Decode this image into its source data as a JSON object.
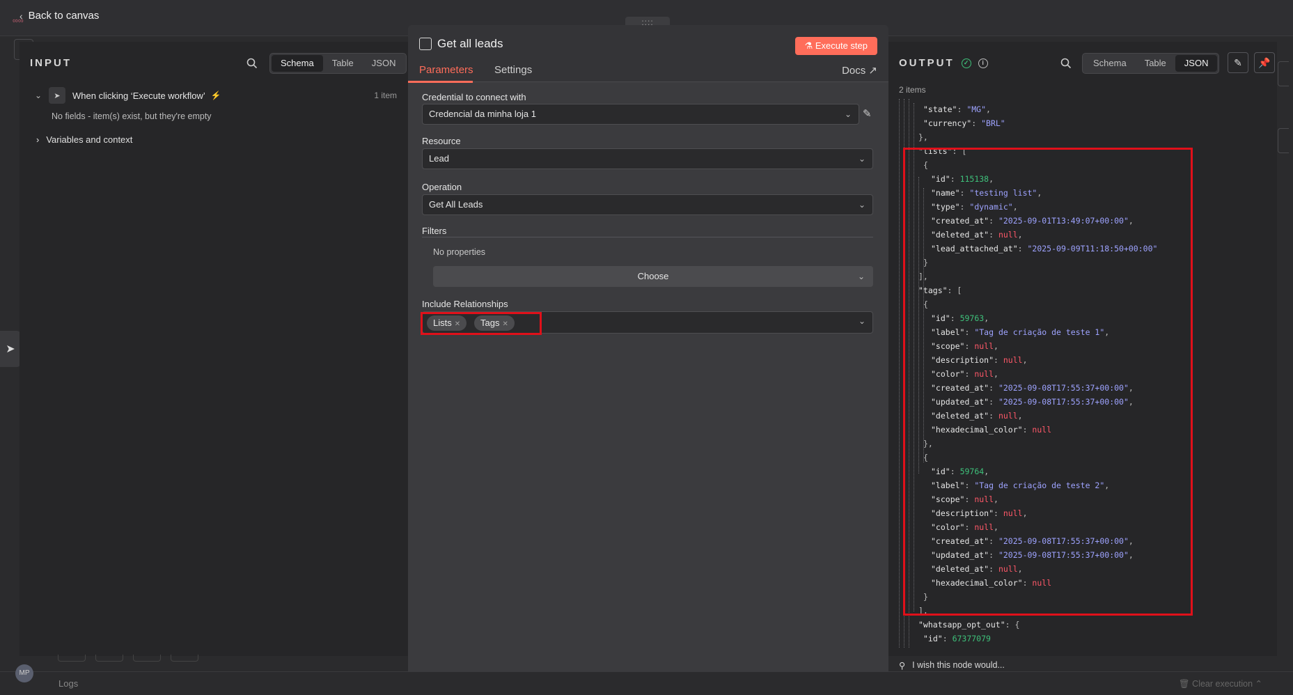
{
  "topbar": {
    "back_label": "Back to canvas",
    "drag_label": "::::"
  },
  "input": {
    "title": "INPUT",
    "view_tabs": [
      "Schema",
      "Table",
      "JSON"
    ],
    "trigger_label": "When clicking ‘Execute workflow’",
    "trigger_count": "1 item",
    "empty_note": "No fields - item(s) exist, but they're empty",
    "variables_label": "Variables and context"
  },
  "node": {
    "title": "Get all leads",
    "execute_label": "Execute step",
    "tabs": [
      "Parameters",
      "Settings"
    ],
    "docs_label": "Docs",
    "credential_label": "Credential to connect with",
    "credential_value": "Credencial da minha loja 1",
    "resource_label": "Resource",
    "resource_value": "Lead",
    "operation_label": "Operation",
    "operation_value": "Get All Leads",
    "filters_label": "Filters",
    "filters_empty": "No properties",
    "choose_label": "Choose",
    "relationships_label": "Include Relationships",
    "relationships": [
      "Lists",
      "Tags"
    ]
  },
  "output": {
    "title": "OUTPUT",
    "view_tabs": [
      "Schema",
      "Table",
      "JSON"
    ],
    "active_tab": "JSON",
    "items_count": "2 items",
    "wish_label": "I wish this node would..."
  },
  "logs": {
    "label": "Logs",
    "clear_label": "Clear execution",
    "avatar_initials": "MP"
  },
  "colors": {
    "accent": "#ff6d5a",
    "highlight": "#e0101a",
    "success": "#3ec07a",
    "string": "#9ea3ff",
    "number": "#3ec07a",
    "null": "#ff5868"
  }
}
